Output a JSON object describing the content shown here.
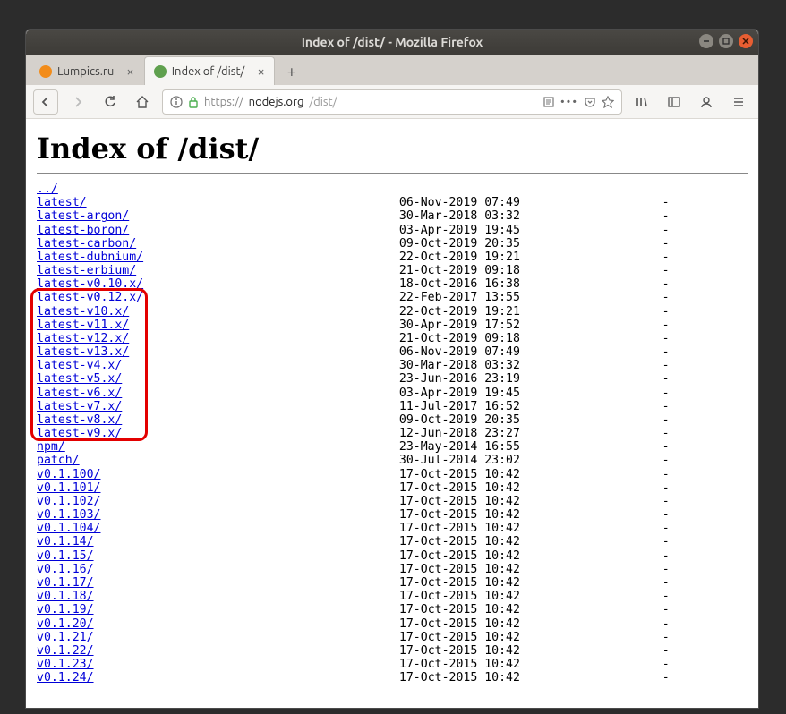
{
  "window": {
    "title": "Index of /dist/ - Mozilla Firefox"
  },
  "tabs": {
    "items": [
      {
        "label": "Lumpics.ru",
        "fav_color": "#f28c1a",
        "active": false
      },
      {
        "label": "Index of /dist/",
        "fav_color": "#5fa04e",
        "active": true
      }
    ]
  },
  "addressbar": {
    "protocol": "https://",
    "domain": "nodejs.org",
    "path": "/dist/"
  },
  "page": {
    "heading": "Index of /dist/"
  },
  "listing": [
    {
      "name": "../",
      "date": "",
      "size": ""
    },
    {
      "name": "latest/",
      "date": "06-Nov-2019 07:49",
      "size": "-"
    },
    {
      "name": "latest-argon/",
      "date": "30-Mar-2018 03:32",
      "size": "-"
    },
    {
      "name": "latest-boron/",
      "date": "03-Apr-2019 19:45",
      "size": "-"
    },
    {
      "name": "latest-carbon/",
      "date": "09-Oct-2019 20:35",
      "size": "-"
    },
    {
      "name": "latest-dubnium/",
      "date": "22-Oct-2019 19:21",
      "size": "-"
    },
    {
      "name": "latest-erbium/",
      "date": "21-Oct-2019 09:18",
      "size": "-"
    },
    {
      "name": "latest-v0.10.x/",
      "date": "18-Oct-2016 16:38",
      "size": "-"
    },
    {
      "name": "latest-v0.12.x/",
      "date": "22-Feb-2017 13:55",
      "size": "-"
    },
    {
      "name": "latest-v10.x/",
      "date": "22-Oct-2019 19:21",
      "size": "-"
    },
    {
      "name": "latest-v11.x/",
      "date": "30-Apr-2019 17:52",
      "size": "-"
    },
    {
      "name": "latest-v12.x/",
      "date": "21-Oct-2019 09:18",
      "size": "-"
    },
    {
      "name": "latest-v13.x/",
      "date": "06-Nov-2019 07:49",
      "size": "-"
    },
    {
      "name": "latest-v4.x/",
      "date": "30-Mar-2018 03:32",
      "size": "-"
    },
    {
      "name": "latest-v5.x/",
      "date": "23-Jun-2016 23:19",
      "size": "-"
    },
    {
      "name": "latest-v6.x/",
      "date": "03-Apr-2019 19:45",
      "size": "-"
    },
    {
      "name": "latest-v7.x/",
      "date": "11-Jul-2017 16:52",
      "size": "-"
    },
    {
      "name": "latest-v8.x/",
      "date": "09-Oct-2019 20:35",
      "size": "-"
    },
    {
      "name": "latest-v9.x/",
      "date": "12-Jun-2018 23:27",
      "size": "-"
    },
    {
      "name": "npm/",
      "date": "23-May-2014 16:55",
      "size": "-"
    },
    {
      "name": "patch/",
      "date": "30-Jul-2014 23:02",
      "size": "-"
    },
    {
      "name": "v0.1.100/",
      "date": "17-Oct-2015 10:42",
      "size": "-"
    },
    {
      "name": "v0.1.101/",
      "date": "17-Oct-2015 10:42",
      "size": "-"
    },
    {
      "name": "v0.1.102/",
      "date": "17-Oct-2015 10:42",
      "size": "-"
    },
    {
      "name": "v0.1.103/",
      "date": "17-Oct-2015 10:42",
      "size": "-"
    },
    {
      "name": "v0.1.104/",
      "date": "17-Oct-2015 10:42",
      "size": "-"
    },
    {
      "name": "v0.1.14/",
      "date": "17-Oct-2015 10:42",
      "size": "-"
    },
    {
      "name": "v0.1.15/",
      "date": "17-Oct-2015 10:42",
      "size": "-"
    },
    {
      "name": "v0.1.16/",
      "date": "17-Oct-2015 10:42",
      "size": "-"
    },
    {
      "name": "v0.1.17/",
      "date": "17-Oct-2015 10:42",
      "size": "-"
    },
    {
      "name": "v0.1.18/",
      "date": "17-Oct-2015 10:42",
      "size": "-"
    },
    {
      "name": "v0.1.19/",
      "date": "17-Oct-2015 10:42",
      "size": "-"
    },
    {
      "name": "v0.1.20/",
      "date": "17-Oct-2015 10:42",
      "size": "-"
    },
    {
      "name": "v0.1.21/",
      "date": "17-Oct-2015 10:42",
      "size": "-"
    },
    {
      "name": "v0.1.22/",
      "date": "17-Oct-2015 10:42",
      "size": "-"
    },
    {
      "name": "v0.1.23/",
      "date": "17-Oct-2015 10:42",
      "size": "-"
    },
    {
      "name": "v0.1.24/",
      "date": "17-Oct-2015 10:42",
      "size": "-"
    }
  ],
  "highlight": {
    "first_index": 8,
    "last_index": 18
  }
}
